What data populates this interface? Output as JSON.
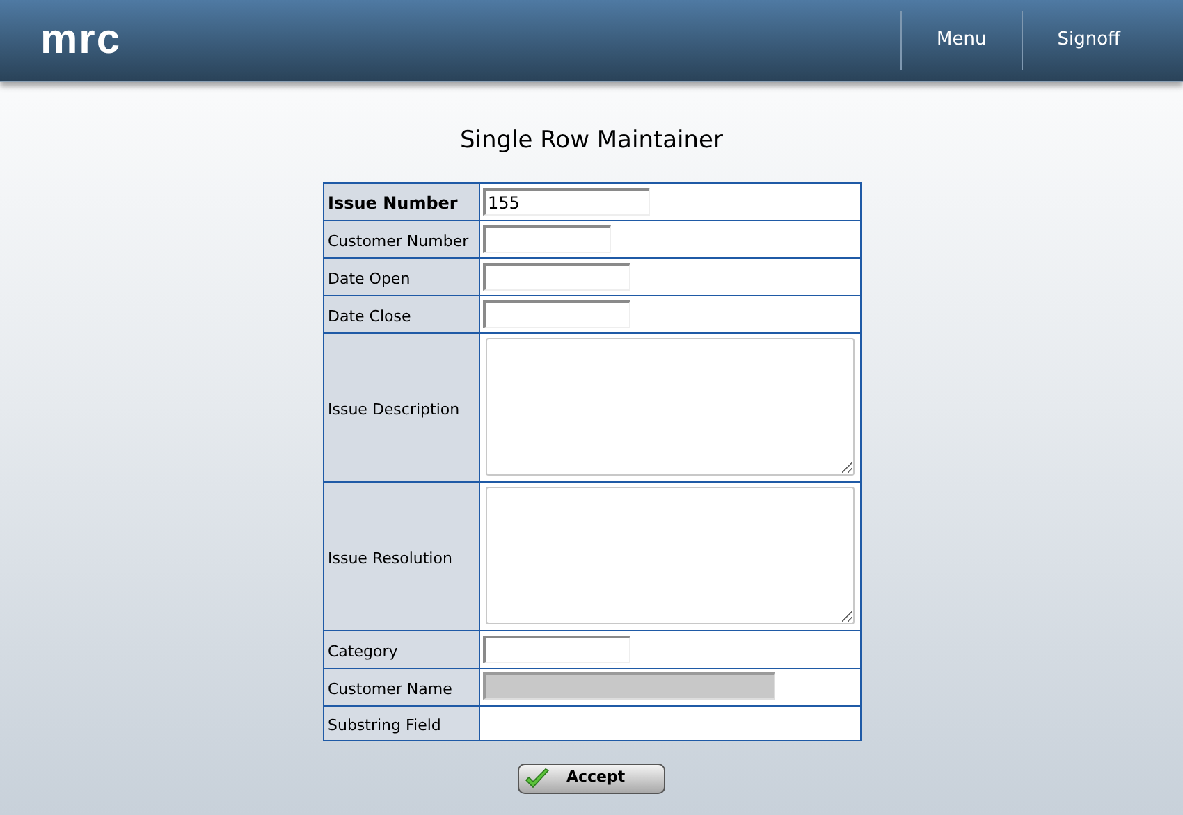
{
  "header": {
    "logo": "mrc",
    "nav": [
      "Menu",
      "Signoff"
    ]
  },
  "title": "Single Row Maintainer",
  "fields": [
    {
      "label": "Issue Number",
      "key": true,
      "kind": "text",
      "value": "155"
    },
    {
      "label": "Customer Number",
      "key": false,
      "kind": "text"
    },
    {
      "label": "Date Open",
      "key": false,
      "kind": "text"
    },
    {
      "label": "Date Close",
      "key": false,
      "kind": "text"
    },
    {
      "label": "Issue Description",
      "key": false,
      "kind": "textarea"
    },
    {
      "label": "Issue Resolution",
      "key": false,
      "kind": "textarea"
    },
    {
      "label": "Category",
      "key": false,
      "kind": "text"
    },
    {
      "label": "Customer Name",
      "key": false,
      "kind": "disabled"
    },
    {
      "label": "Substring Field",
      "key": false,
      "kind": "empty"
    }
  ],
  "accept_button": "Accept"
}
